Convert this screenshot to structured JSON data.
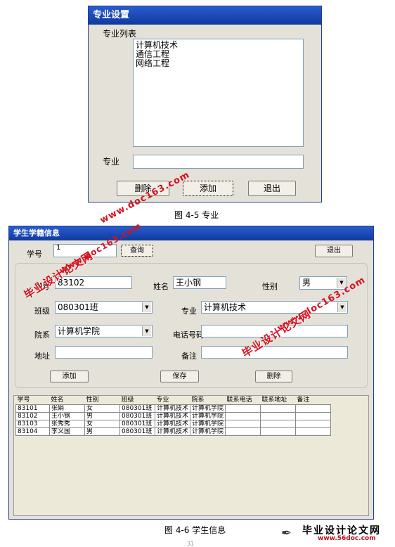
{
  "major_dialog": {
    "title": "专业设置",
    "list_label": "专业列表",
    "items": [
      "计算机技术",
      "通信工程",
      "网络工程"
    ],
    "field_label": "专业",
    "field_value": "",
    "delete_label": "删除",
    "add_label": "添加",
    "exit_label": "退出"
  },
  "caption1": "图 4-5 专业",
  "student_window": {
    "title": "学生学籍信息",
    "query": {
      "label": "学号",
      "value": "1",
      "query_label": "查询",
      "exit_label": "退出"
    },
    "form": {
      "student_no_label": "学号",
      "student_no_value": "83102",
      "name_label": "姓名",
      "name_value": "王小钢",
      "gender_label": "性别",
      "gender_value": "男",
      "class_label": "班级",
      "class_value": "080301班",
      "major_label": "专业",
      "major_value": "计算机技术",
      "dept_label": "院系",
      "dept_value": "计算机学院",
      "phone_label": "电话号码",
      "phone_value": "",
      "address_label": "地址",
      "address_value": "",
      "note_label": "备注",
      "note_value": "",
      "add_label": "添加",
      "save_label": "保存",
      "delete_label": "删除"
    },
    "grid": {
      "headers": [
        "学号",
        "姓名",
        "性别",
        "班级",
        "专业",
        "院系",
        "联系电话",
        "联系地址",
        "备注"
      ],
      "rows": [
        [
          "83101",
          "张娟",
          "女",
          "080301班",
          "计算机技术",
          "计算机学院",
          "",
          "",
          ""
        ],
        [
          "83102",
          "王小钢",
          "男",
          "080301班",
          "计算机技术",
          "计算机学院",
          "",
          "",
          ""
        ],
        [
          "83103",
          "张秀秀",
          "女",
          "080301班",
          "计算机技术",
          "计算机学院",
          "",
          "",
          ""
        ],
        [
          "83104",
          "李义国",
          "男",
          "080301班",
          "计算机技术",
          "计算机学院",
          "",
          "",
          ""
        ]
      ]
    }
  },
  "caption2": "图 4-6 学生信息",
  "watermarks": {
    "text_cn": "毕业设计论文网",
    "text_url": "www.doc163.com",
    "logo_cn": "毕业设计论文网",
    "logo_url": "www.56doc.com",
    "page_number": "31"
  }
}
